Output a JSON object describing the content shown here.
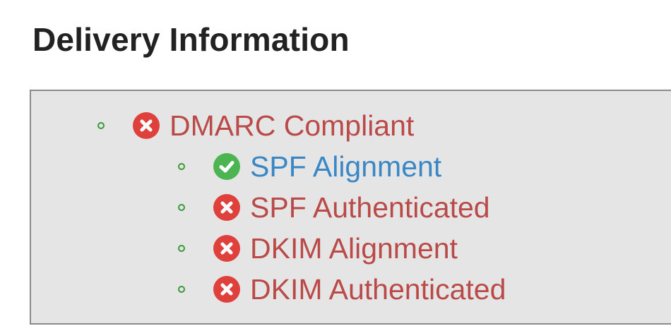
{
  "page": {
    "title": "Delivery Information"
  },
  "colors": {
    "fail": "#e0403c",
    "fail_text": "#b94a48",
    "pass": "#4cb552",
    "pass_text": "#3a87c6",
    "bullet": "#3a9a3a",
    "panel_bg": "#e5e5e5"
  },
  "checks": {
    "dmarc": {
      "label": "DMARC Compliant",
      "status": "fail",
      "icon": "x-circle-icon"
    },
    "spf_alignment": {
      "label": "SPF Alignment",
      "status": "pass",
      "icon": "check-circle-icon"
    },
    "spf_authenticated": {
      "label": "SPF Authenticated",
      "status": "fail",
      "icon": "x-circle-icon"
    },
    "dkim_alignment": {
      "label": "DKIM Alignment",
      "status": "fail",
      "icon": "x-circle-icon"
    },
    "dkim_authenticated": {
      "label": "DKIM Authenticated",
      "status": "fail",
      "icon": "x-circle-icon"
    }
  }
}
